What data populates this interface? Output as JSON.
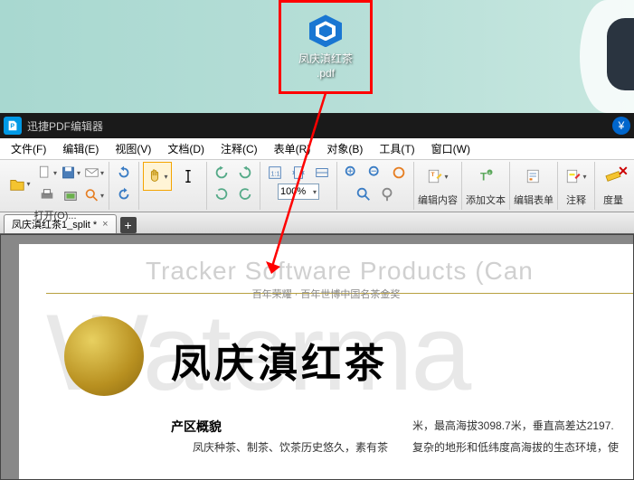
{
  "desktop": {
    "icon_label_line1": "凤庆滇红茶",
    "icon_label_line2": ".pdf"
  },
  "app": {
    "title": "迅捷PDF编辑器",
    "yen_symbol": "¥"
  },
  "menus": {
    "file": "文件(F)",
    "edit": "编辑(E)",
    "view": "视图(V)",
    "document": "文档(D)",
    "annotate": "注释(C)",
    "form": "表单(R)",
    "object": "对象(B)",
    "tools": "工具(T)",
    "window": "窗口(W)"
  },
  "toolbar": {
    "open": "打开(O)...",
    "zoom_value": "100%",
    "edit_content": "编辑内容",
    "add_text": "添加文本",
    "edit_form": "编辑表单",
    "annotate": "注释",
    "measure": "度量"
  },
  "tab": {
    "name": "凤庆滇红茶1_split *",
    "add": "+"
  },
  "doc": {
    "watermark_top": "Tracker Software Products (Can",
    "watermark_big": "Waterma",
    "banner": "百年荣耀 · 百年世博中国名茶金奖",
    "title": "凤庆滇红茶",
    "section": "产区概貌",
    "body_col1": "凤庆种茶、制茶、饮茶历史悠久，素有茶",
    "body_col2_l1": "米，最高海拔3098.7米，垂直高差达2197.",
    "body_col2_l2": "复杂的地形和低纬度高海拔的生态环境，使"
  }
}
